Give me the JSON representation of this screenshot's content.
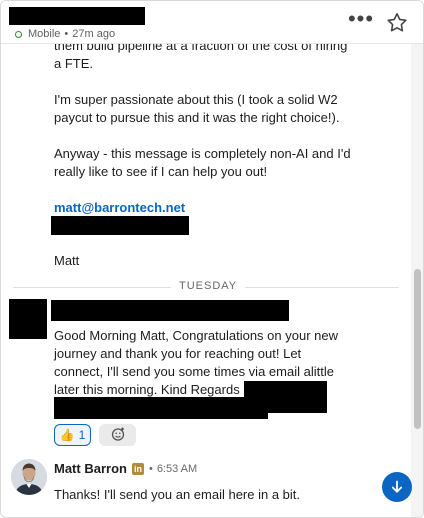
{
  "header": {
    "status_device": "Mobile",
    "status_separator": "•",
    "status_time": "27m ago",
    "more_label": "•••",
    "icons": {
      "status": "mobile-status-dot",
      "more": "more-options-icon",
      "star": "star-icon"
    }
  },
  "messages": {
    "first": {
      "partial_line": "them build pipeline at a fraction of the cost of hiring",
      "line_fte": "a FTE.",
      "para_1_line_1": "I'm super passionate about this (I took a solid W2",
      "para_1_line_2": "paycut to pursue this and it was the right choice!).",
      "para_2_line_1": "Anyway - this message is completely non-AI and I'd",
      "para_2_line_2": "really like to see if I can help you out!",
      "email": "matt@barrontech.net",
      "signoff": "Matt"
    },
    "day_divider": "TUESDAY",
    "second": {
      "line_1": "Good Morning Matt, Congratulations on your new",
      "line_2": "journey and thank you for reaching out! Let",
      "line_3": "connect, I'll send you some times via email alittle",
      "line_4": "later this morning. Kind Regards",
      "reactions": [
        {
          "emoji": "👍",
          "count": "1",
          "icon": "thumbs-up-icon"
        },
        {
          "emoji": "",
          "icon": "add-reaction-icon"
        }
      ]
    },
    "third": {
      "sender": "Matt Barron",
      "badge": "in",
      "separator": "•",
      "time": "6:53 AM",
      "text": "Thanks! I'll send you an email here in a bit."
    }
  },
  "colors": {
    "link": "#0a66c2",
    "badge": "#b3893b",
    "status": "#2f8a3b"
  }
}
